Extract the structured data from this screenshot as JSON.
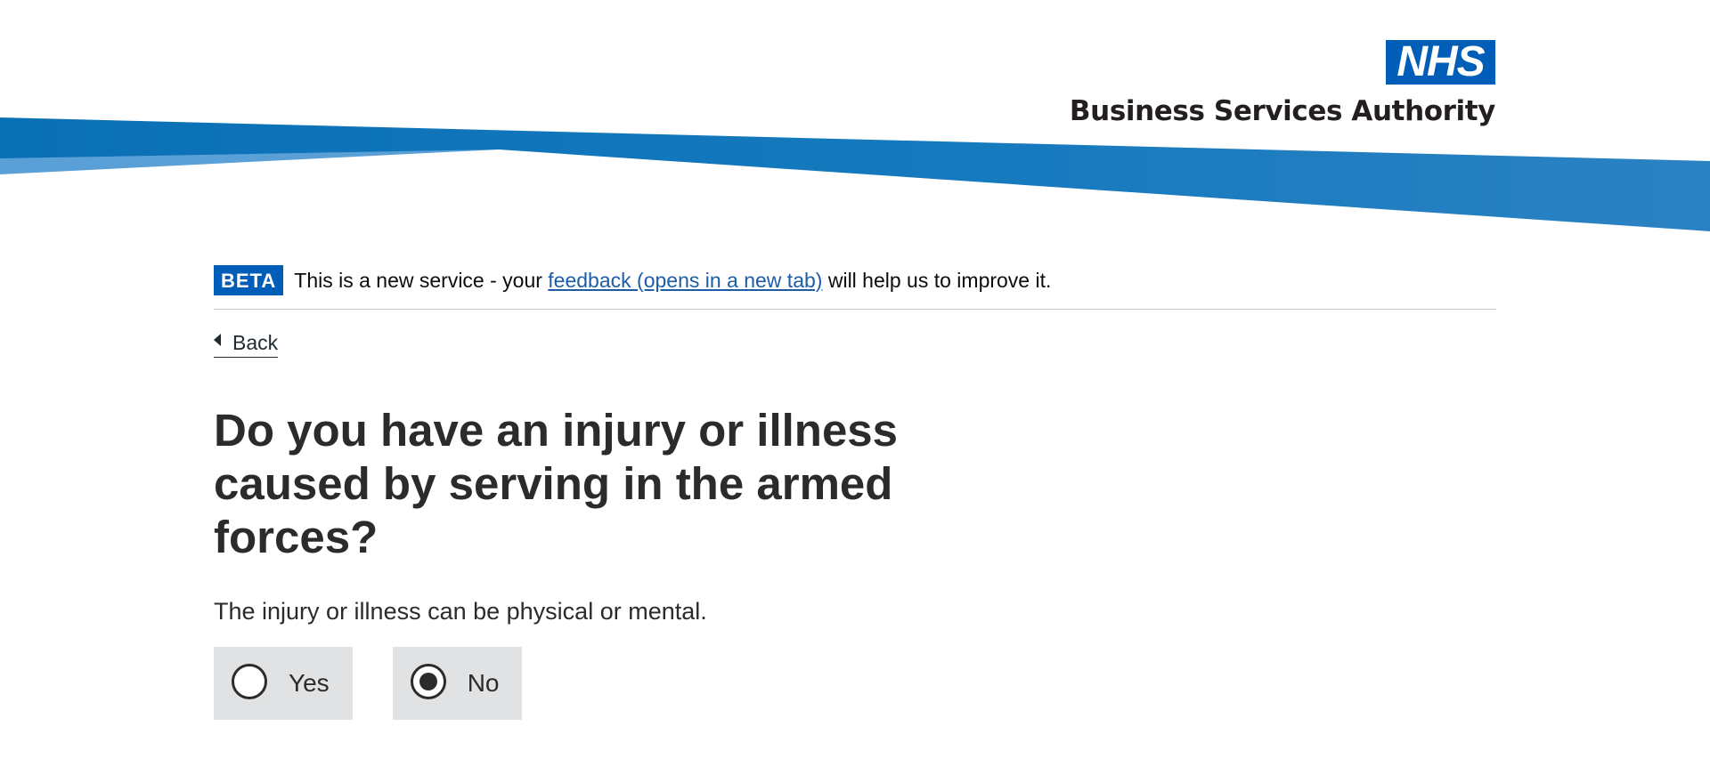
{
  "header": {
    "logo_mark": "NHS",
    "org_name": "Business Services Authority",
    "brand_color": "#005eb8"
  },
  "phase_banner": {
    "tag": "BETA",
    "text_before": "This is a new service - your ",
    "link_text": "feedback (opens in a new tab)",
    "text_after": " will help us to improve it."
  },
  "back_link": {
    "label": "Back",
    "icon": "chevron-left-icon"
  },
  "question": {
    "heading": "Do you have an injury or illness caused by serving in the armed forces?",
    "hint": "The injury or illness can be physical or mental.",
    "options": [
      {
        "label": "Yes",
        "checked": false
      },
      {
        "label": "No",
        "checked": true
      }
    ]
  }
}
